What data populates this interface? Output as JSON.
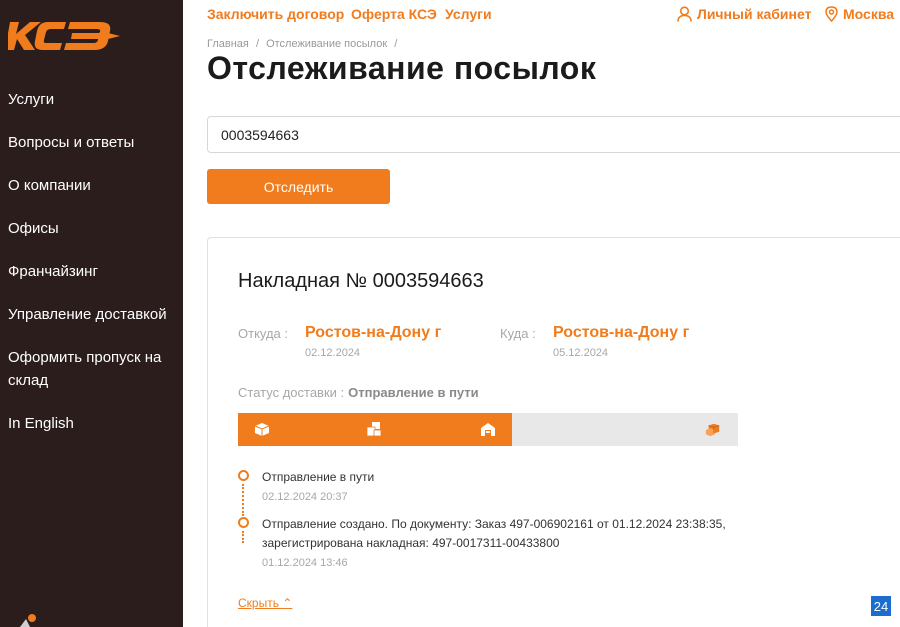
{
  "brand": {
    "logo_text": "КСЭ",
    "accent": "#f07c1d",
    "sidebar_bg": "#2b1d1b"
  },
  "sidebar": {
    "items": [
      {
        "label": "Услуги"
      },
      {
        "label": "Вопросы и ответы"
      },
      {
        "label": "О компании"
      },
      {
        "label": "Офисы"
      },
      {
        "label": "Франчайзинг"
      },
      {
        "label": "Управление доставкой"
      },
      {
        "label": "Оформить пропуск на склад"
      },
      {
        "label": "In English"
      }
    ]
  },
  "topbar": {
    "links": [
      {
        "label": "Заключить договор"
      },
      {
        "label": "Оферта КСЭ"
      },
      {
        "label": "Услуги"
      }
    ],
    "cabinet": "Личный кабинет",
    "city": "Москва"
  },
  "breadcrumb": {
    "home": "Главная",
    "separator": "/",
    "current": "Отслеживание посылок",
    "trailing": "/"
  },
  "page": {
    "title": "Отслеживание посылок"
  },
  "search": {
    "value": "0003594663",
    "button": "Отследить"
  },
  "invoice": {
    "title": "Накладная № 0003594663",
    "from_label": "Откуда :",
    "from_city": "Ростов-на-Дону г",
    "from_date": "02.12.2024",
    "to_label": "Куда :",
    "to_city": "Ростов-на-Дону г",
    "to_date": "05.12.2024",
    "status_label": "Статус доставки :",
    "status_value": "Отправление в пути",
    "progress_fraction": 0.548,
    "stage_icons": [
      "box-icon",
      "parcels-icon",
      "warehouse-icon",
      "delivered-boxes-icon"
    ]
  },
  "events": [
    {
      "text": "Отправление в пути",
      "date": "02.12.2024 20:37"
    },
    {
      "text": "Отправление создано. По документу: Заказ 497-006902161 от 01.12.2024 23:38:35, зарегистрирована накладная: 497-0017311-00433800",
      "date": "01.12.2024 13:46"
    }
  ],
  "hide_link": "Скрыть",
  "badge": "24"
}
